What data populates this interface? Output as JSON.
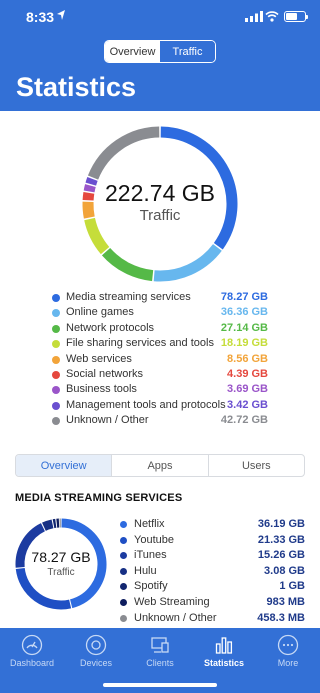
{
  "status_bar": {
    "time": "8:33"
  },
  "view_switch": {
    "overview": "Overview",
    "traffic": "Traffic",
    "selected": "Traffic"
  },
  "page_title": "Statistics",
  "total": {
    "value": "222.74 GB",
    "label": "Traffic"
  },
  "categories": [
    {
      "name": "Media streaming services",
      "value": "78.27 GB",
      "gb": 78.27,
      "color": "#2d6be0"
    },
    {
      "name": "Online games",
      "value": "36.36 GB",
      "gb": 36.36,
      "color": "#67b7ee"
    },
    {
      "name": "Network protocols",
      "value": "27.14 GB",
      "gb": 27.14,
      "color": "#55b947"
    },
    {
      "name": "File sharing services and tools",
      "value": "18.19 GB",
      "gb": 18.19,
      "color": "#c5dd3a"
    },
    {
      "name": "Web services",
      "value": "8.56 GB",
      "gb": 8.56,
      "color": "#f2a43a"
    },
    {
      "name": "Social networks",
      "value": "4.39 GB",
      "gb": 4.39,
      "color": "#e5483e"
    },
    {
      "name": "Business tools",
      "value": "3.69 GB",
      "gb": 3.69,
      "color": "#9a55c9"
    },
    {
      "name": "Management tools and protocols",
      "value": "3.42 GB",
      "gb": 3.42,
      "color": "#6a4fd0"
    },
    {
      "name": "Unknown / Other",
      "value": "42.72 GB",
      "gb": 42.72,
      "color": "#8a8c91"
    }
  ],
  "detail_tabs": [
    "Overview",
    "Apps",
    "Users"
  ],
  "section_title": "MEDIA STREAMING SERVICES",
  "media": {
    "value": "78.27 GB",
    "label": "Traffic",
    "items": [
      {
        "name": "Netflix",
        "value": "36.19 GB",
        "gb": 36.19,
        "color": "#2d6be0"
      },
      {
        "name": "Youtube",
        "value": "21.33 GB",
        "gb": 21.33,
        "color": "#1f4fc4"
      },
      {
        "name": "iTunes",
        "value": "15.26 GB",
        "gb": 15.26,
        "color": "#1c3ba0"
      },
      {
        "name": "Hulu",
        "value": "3.08 GB",
        "gb": 3.08,
        "color": "#173085"
      },
      {
        "name": "Spotify",
        "value": "1 GB",
        "gb": 1,
        "color": "#122670"
      },
      {
        "name": "Web Streaming",
        "value": "983 MB",
        "gb": 0.983,
        "color": "#0e1d5e"
      },
      {
        "name": "Unknown / Other",
        "value": "458.3 MB",
        "gb": 0.458,
        "color": "#8a8c91"
      }
    ]
  },
  "tabbar": [
    {
      "label": "Dashboard",
      "icon": "dashboard-icon"
    },
    {
      "label": "Devices",
      "icon": "devices-icon"
    },
    {
      "label": "Clients",
      "icon": "clients-icon"
    },
    {
      "label": "Statistics",
      "icon": "statistics-icon",
      "active": true
    },
    {
      "label": "More",
      "icon": "more-icon"
    }
  ]
}
